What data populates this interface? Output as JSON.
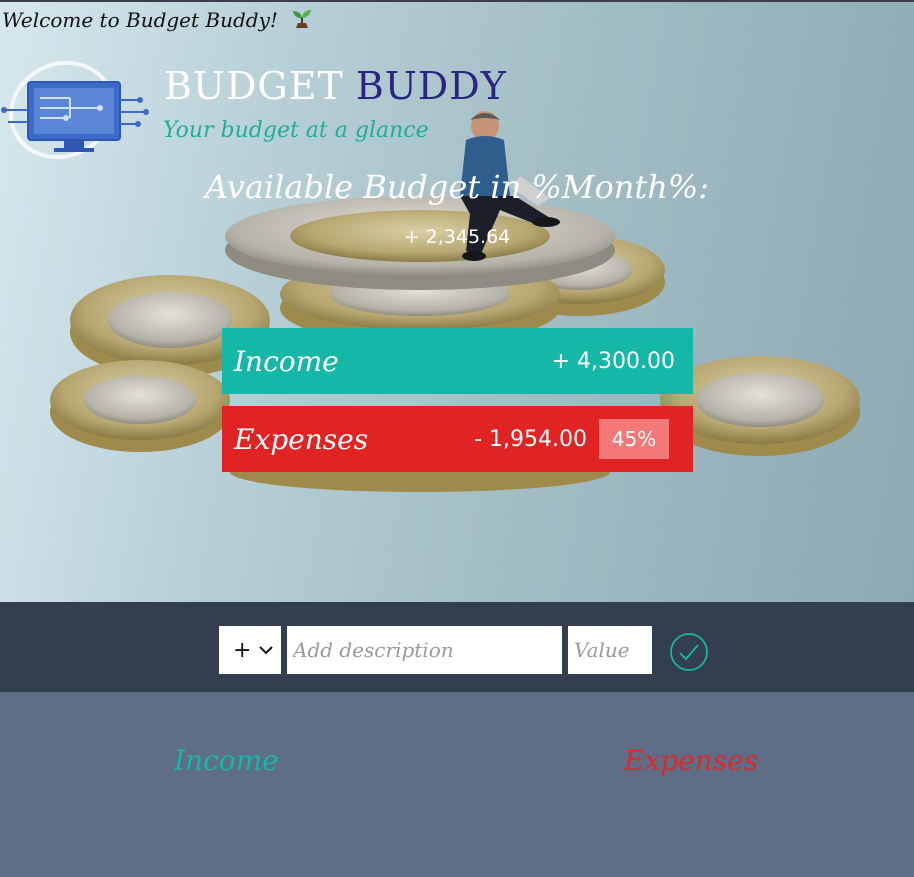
{
  "header": {
    "welcome_prefix": "Welcome to",
    "welcome_app": "Budget Buddy!",
    "sprout_icon": "seedling-icon"
  },
  "brand": {
    "logo_icon": "circuit-monitor-logo",
    "name_part1": "BUDGET",
    "name_part2": "BUDDY",
    "tagline": "Your budget at a glance",
    "colors": {
      "part1": "#ffffff",
      "part2": "#2a2680",
      "tagline": "#1fae98"
    }
  },
  "budget": {
    "title": "Available Budget in %Month%:",
    "value": "+ 2,345.64"
  },
  "summary": {
    "income": {
      "label": "Income",
      "value": "+ 4,300.00",
      "color": "#15b8a7"
    },
    "expenses": {
      "label": "Expenses",
      "value": "- 1,954.00",
      "percentage": "45%",
      "color": "#e02424",
      "badge_color": "#f57878"
    }
  },
  "add_bar": {
    "type_select": {
      "selected": "+",
      "options": [
        "+",
        "-"
      ]
    },
    "description": {
      "placeholder": "Add description",
      "value": ""
    },
    "value": {
      "placeholder": "Value",
      "value": ""
    },
    "submit_icon": "checkmark-circle-icon",
    "bar_color": "#333e50"
  },
  "lists": {
    "income_title": "Income",
    "expenses_title": "Expenses",
    "background": "#5f6e87"
  }
}
